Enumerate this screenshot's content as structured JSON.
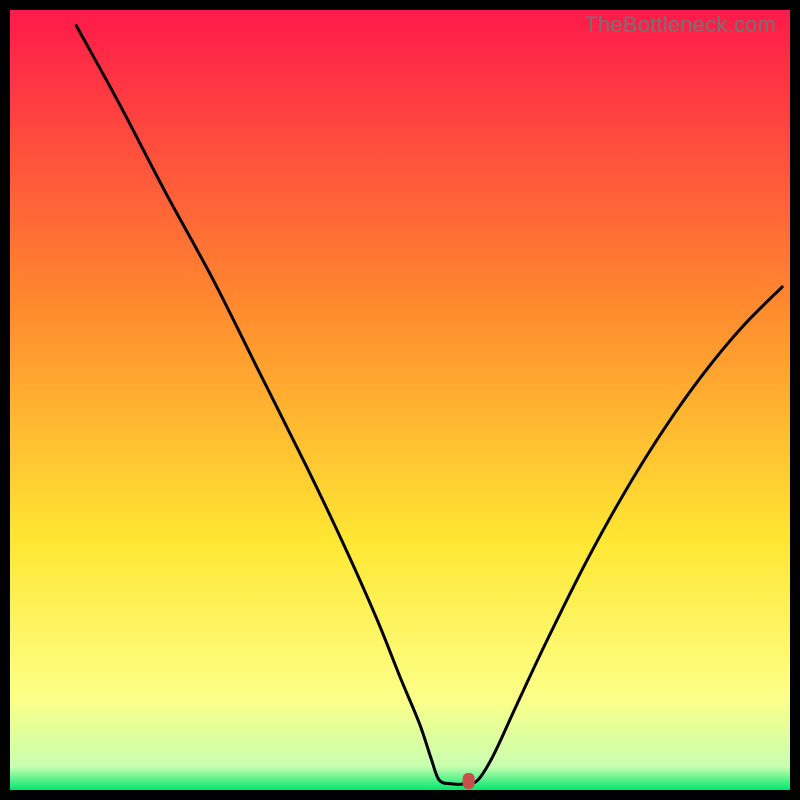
{
  "watermark": "TheBottleneck.com",
  "chart_data": {
    "type": "line",
    "title": "",
    "xlabel": "",
    "ylabel": "",
    "xlim": [
      0,
      100
    ],
    "ylim": [
      0,
      100
    ],
    "gradient_colors": {
      "top": "#ff1a4a",
      "mid1": "#ff8a2e",
      "mid2": "#ffe733",
      "mid3": "#fdff87",
      "bottom": "#00e86e"
    },
    "curve": {
      "comment": "Bottleneck-style V curve. x is percent across, y is percent height (0 bottom, 100 top).",
      "points": [
        {
          "x": 8.5,
          "y": 98.0
        },
        {
          "x": 14.0,
          "y": 88.0
        },
        {
          "x": 20.0,
          "y": 76.5
        },
        {
          "x": 26.0,
          "y": 65.5
        },
        {
          "x": 32.0,
          "y": 53.5
        },
        {
          "x": 38.0,
          "y": 41.5
        },
        {
          "x": 43.0,
          "y": 31.0
        },
        {
          "x": 47.0,
          "y": 22.0
        },
        {
          "x": 50.0,
          "y": 14.5
        },
        {
          "x": 52.5,
          "y": 8.5
        },
        {
          "x": 54.0,
          "y": 4.0
        },
        {
          "x": 55.0,
          "y": 1.3
        },
        {
          "x": 56.5,
          "y": 0.8
        },
        {
          "x": 58.5,
          "y": 0.8
        },
        {
          "x": 60.0,
          "y": 1.3
        },
        {
          "x": 62.0,
          "y": 4.5
        },
        {
          "x": 65.0,
          "y": 11.0
        },
        {
          "x": 69.0,
          "y": 19.5
        },
        {
          "x": 74.0,
          "y": 29.5
        },
        {
          "x": 79.0,
          "y": 38.5
        },
        {
          "x": 84.0,
          "y": 46.5
        },
        {
          "x": 89.0,
          "y": 53.5
        },
        {
          "x": 94.0,
          "y": 59.5
        },
        {
          "x": 99.0,
          "y": 64.5
        }
      ]
    },
    "marker": {
      "x": 58.8,
      "y": 0.9,
      "color": "#c94f4f"
    }
  }
}
